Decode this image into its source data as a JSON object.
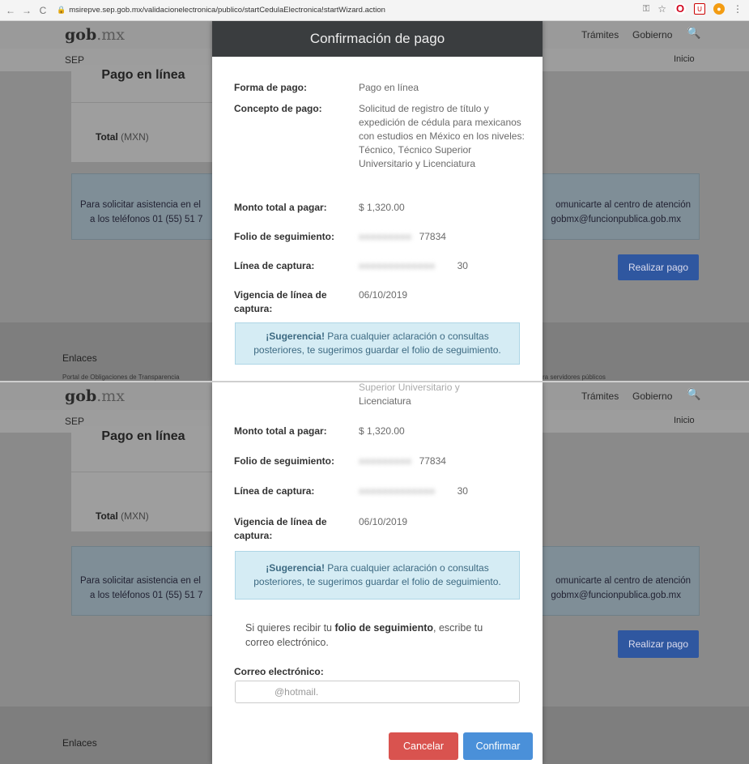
{
  "browser": {
    "url": "msirepve.sep.gob.mx/validacionelectronica/publico/startCedulaElectronica!startWizard.action"
  },
  "site": {
    "logo_gob": "gob",
    "logo_mx": ".mx",
    "nav_tramites": "Trámites",
    "nav_gobierno": "Gobierno",
    "sep": "SEP",
    "inicio": "Inicio",
    "pago_en_linea": "Pago en línea",
    "total_label": "Total",
    "total_unit": "(MXN)",
    "assist_left_1": "Para solicitar asistencia en el",
    "assist_left_2": "a los teléfonos 01 (55) 51 7",
    "assist_right_1": "omunicarte al centro de atención",
    "assist_right_2": "gobmx@funcionpublica.gob.mx",
    "realizar_pago": "Realizar pago",
    "enlaces": "Enlaces",
    "footer_small_left": "Portal de Obligaciones de Transparencia",
    "footer_small_right": "ra servidores públicos"
  },
  "modal": {
    "title": "Confirmación de pago",
    "forma_pago_label": "Forma de pago:",
    "forma_pago_value": "Pago en línea",
    "concepto_label": "Concepto de pago:",
    "concepto_value": "Solicitud de registro de título y expedición de cédula para mexicanos con estudios en México en los niveles: Técnico, Técnico Superior Universitario y Licenciatura",
    "concepto_tail_1": "Superior Universitario y",
    "concepto_tail_2": "Licenciatura",
    "monto_label": "Monto total a pagar:",
    "monto_value": "$ 1,320.00",
    "folio_label": "Folio de seguimiento:",
    "folio_value": "77834",
    "linea_label": "Línea de captura:",
    "linea_value": "30",
    "vigencia_label": "Vigencia de línea de captura:",
    "vigencia_value": "06/10/2019",
    "sugerencia_bold": "¡Sugerencia!",
    "sugerencia_text": "Para cualquier aclaración o consultas posteriores, te sugerimos guardar el folio de seguimiento.",
    "email_prompt_pre": "Si quieres recibir tu",
    "email_prompt_bold": "folio de seguimiento",
    "email_prompt_post": ", escribe tu correo electrónico.",
    "email_label": "Correo electrónico:",
    "email_value": "@hotmail.",
    "cancel_label": "Cancelar",
    "confirm_label": "Confirmar"
  },
  "colors": {
    "modal_header": "#3a3d3f",
    "alert_bg": "#d5ecf4",
    "cancel": "#d9534f",
    "confirm": "#4a90d9",
    "pay_button": "#2f57a0"
  }
}
